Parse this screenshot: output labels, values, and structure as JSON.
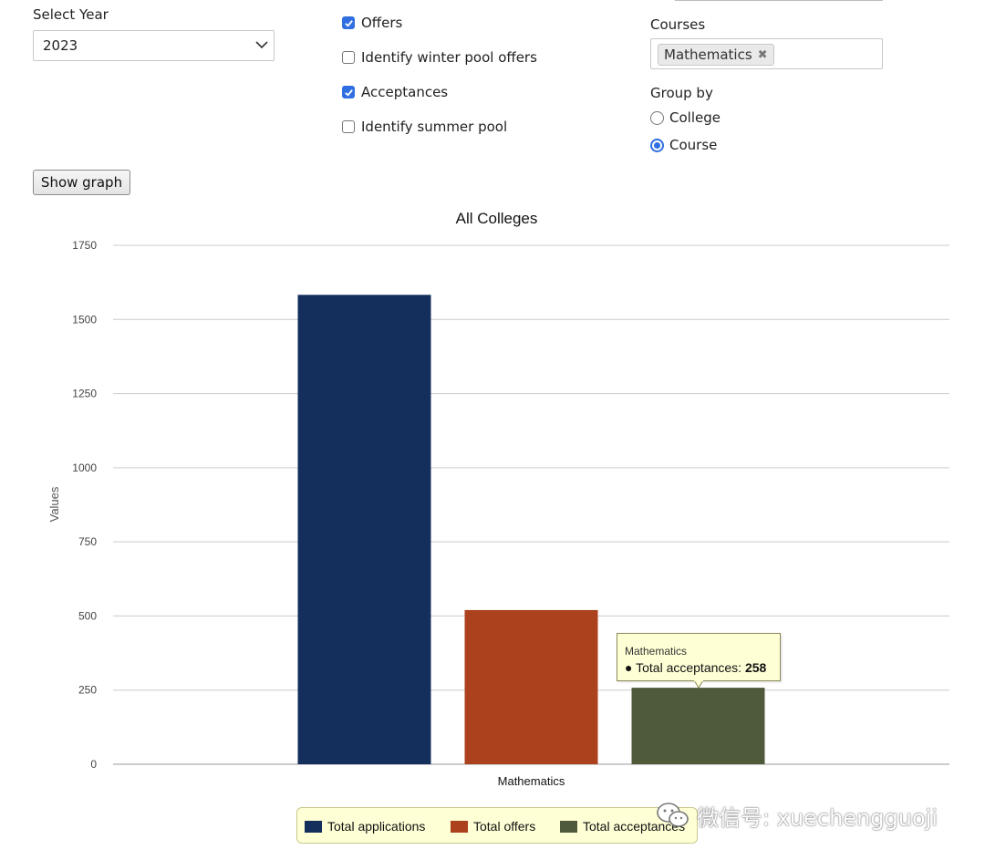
{
  "filters": {
    "year_label": "Select Year",
    "year_value": "2023",
    "checkboxes": [
      {
        "label": "Offers",
        "checked": true
      },
      {
        "label": "Identify winter pool offers",
        "checked": false
      },
      {
        "label": "Acceptances",
        "checked": true
      },
      {
        "label": "Identify summer pool",
        "checked": false
      }
    ],
    "courses_label": "Courses",
    "selected_course": "Mathematics",
    "remove_icon": "close-icon",
    "group_by_label": "Group by",
    "group_by_options": [
      {
        "label": "College",
        "selected": false
      },
      {
        "label": "Course",
        "selected": true
      }
    ],
    "show_graph_label": "Show graph"
  },
  "chart_data": {
    "type": "bar",
    "title": "All Colleges",
    "ylabel": "Values",
    "xlabel": "",
    "categories": [
      "Mathematics"
    ],
    "ylim": [
      0,
      1750
    ],
    "yticks": [
      0,
      250,
      500,
      750,
      1000,
      1250,
      1500,
      1750
    ],
    "grid": true,
    "legend_position": "bottom",
    "series": [
      {
        "name": "Total applications",
        "values": [
          1583
        ],
        "color": "#142f5b"
      },
      {
        "name": "Total offers",
        "values": [
          520
        ],
        "color": "#ac411e"
      },
      {
        "name": "Total acceptances",
        "values": [
          258
        ],
        "color": "#4f5a3a"
      }
    ]
  },
  "tooltip": {
    "title": "Mathematics",
    "series": "Total acceptances:",
    "value": "258"
  },
  "watermark": {
    "text": "微信号: xuechengguoji",
    "icon": "wechat-icon"
  }
}
